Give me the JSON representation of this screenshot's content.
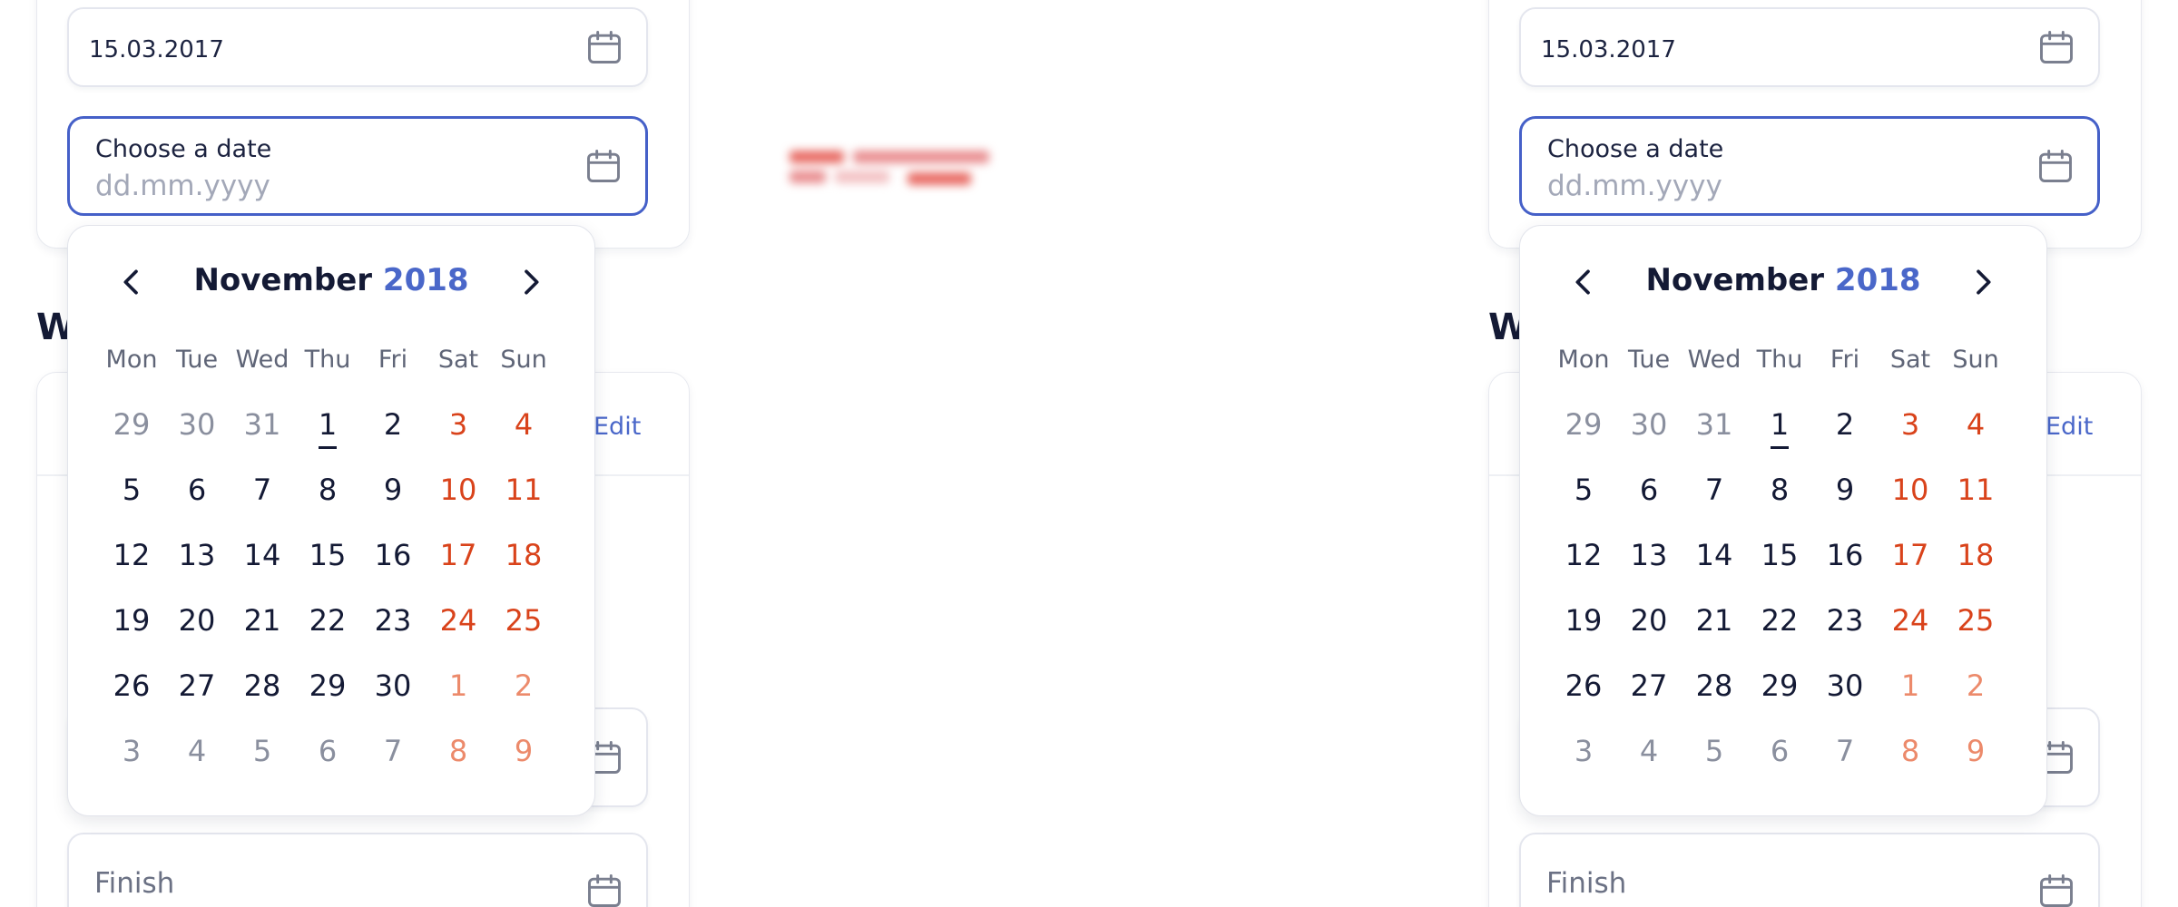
{
  "panels": [
    {
      "date_value": "15.03.2017",
      "choose_label": "Choose a date",
      "choose_placeholder": "dd.mm.yyyy",
      "section_heading_initial": "W",
      "edit_label": "Edit",
      "finish_label": "Finish"
    },
    {
      "date_value": "15.03.2017",
      "choose_label": "Choose a date",
      "choose_placeholder": "dd.mm.yyyy",
      "section_heading_initial": "W",
      "edit_label": "Edit",
      "finish_label": "Finish"
    }
  ],
  "calendar": {
    "month": "November",
    "year": "2018",
    "weekdays": [
      "Mon",
      "Tue",
      "Wed",
      "Thu",
      "Fri",
      "Sat",
      "Sun"
    ],
    "weeks": [
      [
        {
          "d": "29",
          "m": true
        },
        {
          "d": "30",
          "m": true
        },
        {
          "d": "31",
          "m": true
        },
        {
          "d": "1",
          "today": true
        },
        {
          "d": "2"
        },
        {
          "d": "3"
        },
        {
          "d": "4"
        }
      ],
      [
        {
          "d": "5"
        },
        {
          "d": "6"
        },
        {
          "d": "7"
        },
        {
          "d": "8"
        },
        {
          "d": "9"
        },
        {
          "d": "10"
        },
        {
          "d": "11"
        }
      ],
      [
        {
          "d": "12"
        },
        {
          "d": "13"
        },
        {
          "d": "14"
        },
        {
          "d": "15"
        },
        {
          "d": "16"
        },
        {
          "d": "17"
        },
        {
          "d": "18"
        }
      ],
      [
        {
          "d": "19"
        },
        {
          "d": "20"
        },
        {
          "d": "21"
        },
        {
          "d": "22"
        },
        {
          "d": "23"
        },
        {
          "d": "24"
        },
        {
          "d": "25"
        }
      ],
      [
        {
          "d": "26"
        },
        {
          "d": "27"
        },
        {
          "d": "28"
        },
        {
          "d": "29"
        },
        {
          "d": "30"
        },
        {
          "d": "1",
          "m": true
        },
        {
          "d": "2",
          "m": true
        }
      ],
      [
        {
          "d": "3",
          "m": true
        },
        {
          "d": "4",
          "m": true
        },
        {
          "d": "5",
          "m": true
        },
        {
          "d": "6",
          "m": true
        },
        {
          "d": "7",
          "m": true
        },
        {
          "d": "8",
          "m": true
        },
        {
          "d": "9",
          "m": true
        }
      ]
    ]
  },
  "colors": {
    "accent": "#4a67c9",
    "focus_border": "#4560c8",
    "weekend": "#d9431b",
    "weekend_muted": "#ec8a6b",
    "text": "#141a35",
    "muted": "#8a8f9e"
  },
  "icons": {
    "calendar": "calendar-icon",
    "prev": "chevron-left-icon",
    "next": "chevron-right-icon"
  }
}
